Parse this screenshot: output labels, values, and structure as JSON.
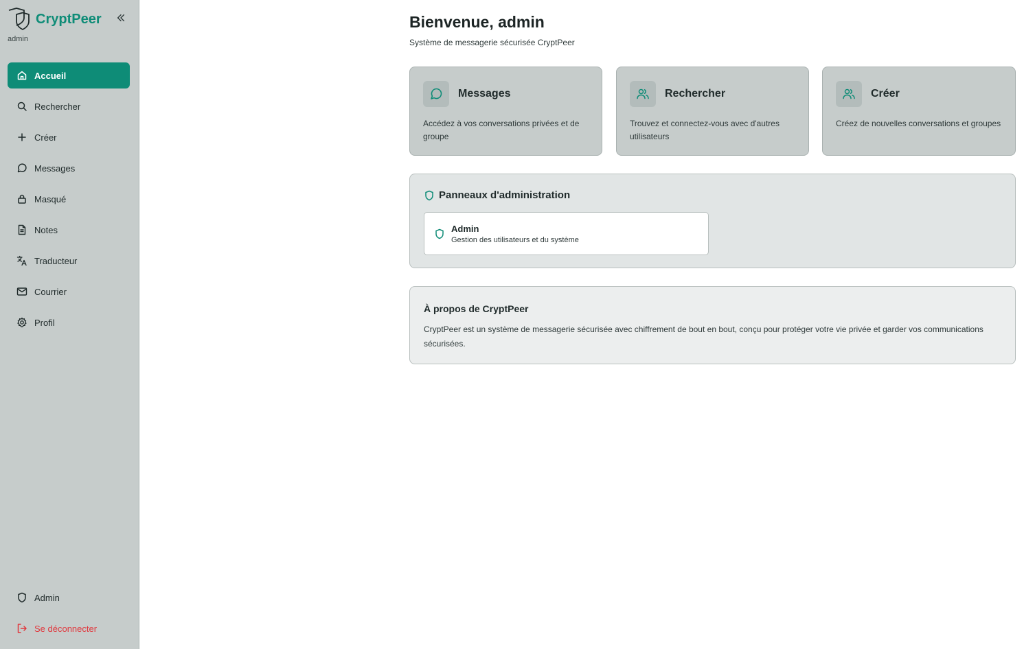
{
  "sidebar": {
    "brand_name": "CryptPeer",
    "brand_sub": "admin",
    "items": [
      {
        "label": "Accueil",
        "icon": "home-icon",
        "active": true
      },
      {
        "label": "Rechercher",
        "icon": "search-icon"
      },
      {
        "label": "Créer",
        "icon": "plus-icon"
      },
      {
        "label": "Messages",
        "icon": "message-icon"
      },
      {
        "label": "Masqué",
        "icon": "lock-icon"
      },
      {
        "label": "Notes",
        "icon": "note-icon"
      },
      {
        "label": "Traducteur",
        "icon": "translate-icon"
      },
      {
        "label": "Courrier",
        "icon": "mail-icon"
      },
      {
        "label": "Profil",
        "icon": "gear-icon"
      }
    ],
    "bottom": {
      "admin_label": "Admin",
      "logout_label": "Se déconnecter"
    }
  },
  "main": {
    "title": "Bienvenue, admin",
    "subtitle": "Système de messagerie sécurisée CryptPeer",
    "cards": [
      {
        "title": "Messages",
        "desc": "Accédez à vos conversations privées et de groupe",
        "icon": "message-icon"
      },
      {
        "title": "Rechercher",
        "desc": "Trouvez et connectez-vous avec d'autres utilisateurs",
        "icon": "users-icon"
      },
      {
        "title": "Créer",
        "desc": "Créez de nouvelles conversations et groupes",
        "icon": "users-icon"
      }
    ],
    "admin_panel": {
      "title": "Panneaux d'administration",
      "card_title": "Admin",
      "card_desc": "Gestion des utilisateurs et du système"
    },
    "about": {
      "title": "À propos de CryptPeer",
      "text": "CryptPeer est un système de messagerie sécurisée avec chiffrement de bout en bout, conçu pour protéger votre vie privée et garder vos communications sécurisées."
    }
  },
  "colors": {
    "accent": "#0e8c77",
    "sidebar_bg": "#c6cccb",
    "logout": "#e0383e"
  }
}
